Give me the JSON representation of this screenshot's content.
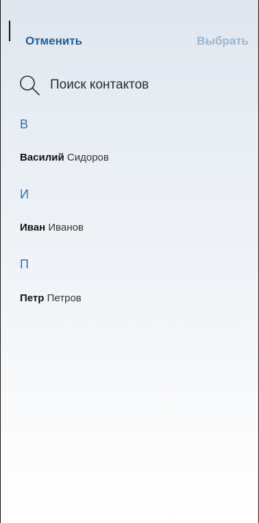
{
  "nav": {
    "cancel_label": "Отменить",
    "select_label": "Выбрать"
  },
  "search": {
    "placeholder": "Поиск контактов",
    "value": ""
  },
  "icons": {
    "search": "search-icon"
  },
  "colors": {
    "accent": "#1d5f95",
    "section_header": "#2a74ad",
    "disabled_action": "#9ab7cd"
  },
  "sections": [
    {
      "letter": "В",
      "contacts": [
        {
          "first_name": "Василий",
          "last_name": "Сидоров"
        }
      ]
    },
    {
      "letter": "И",
      "contacts": [
        {
          "first_name": "Иван",
          "last_name": "Иванов"
        }
      ]
    },
    {
      "letter": "П",
      "contacts": [
        {
          "first_name": "Петр",
          "last_name": "Петров"
        }
      ]
    }
  ]
}
